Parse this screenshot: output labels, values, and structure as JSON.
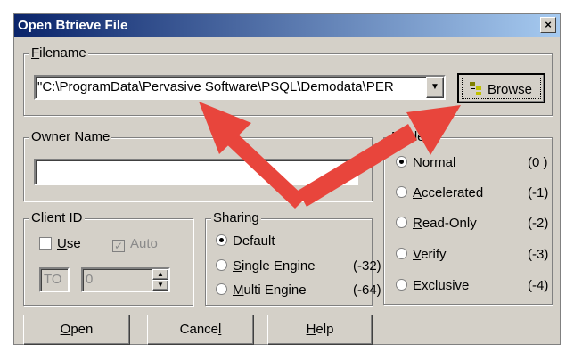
{
  "window": {
    "title": "Open Btrieve File",
    "close": "×"
  },
  "filename": {
    "group_label": "Filename",
    "value": "\"C:\\ProgramData\\Pervasive Software\\PSQL\\Demodata\\PER",
    "browse_label": "Browse"
  },
  "owner": {
    "group_label": "Owner Name",
    "value": ""
  },
  "client": {
    "group_label": "Client ID",
    "use_label": "Use",
    "auto_label": "Auto",
    "id_prefix": "TO",
    "id_value": "0"
  },
  "sharing": {
    "group_label": "Sharing",
    "options": [
      {
        "label": "Default",
        "code": "",
        "selected": true
      },
      {
        "label": "Single Engine",
        "code": "(-32)",
        "selected": false
      },
      {
        "label": "Multi Engine",
        "code": "(-64)",
        "selected": false
      }
    ]
  },
  "mode": {
    "group_label": "Mode",
    "options": [
      {
        "label": "Normal",
        "code": "(0 )",
        "selected": true
      },
      {
        "label": "Accelerated",
        "code": "(-1)",
        "selected": false
      },
      {
        "label": "Read-Only",
        "code": "(-2)",
        "selected": false
      },
      {
        "label": "Verify",
        "code": "(-3)",
        "selected": false
      },
      {
        "label": "Exclusive",
        "code": "(-4)",
        "selected": false
      }
    ]
  },
  "buttons": {
    "open": "Open",
    "cancel": "Cancel",
    "help": "Help"
  },
  "colors": {
    "arrow": "#e8453c",
    "titlebar": "#0a246a",
    "face": "#d4d0c8"
  }
}
